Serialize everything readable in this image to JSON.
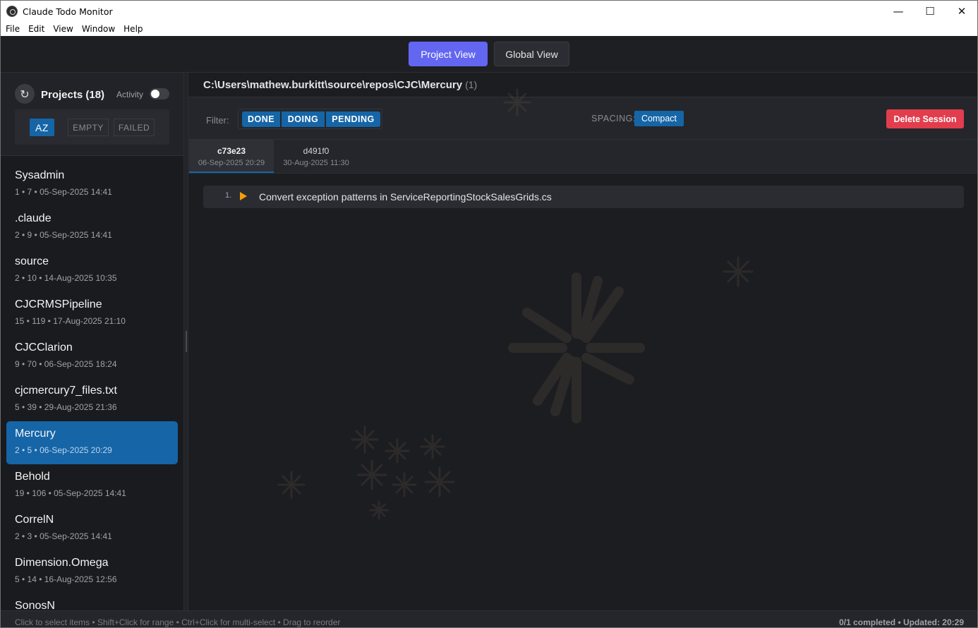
{
  "window": {
    "title": "Claude Todo Monitor",
    "minimize_glyph": "—",
    "maximize_glyph": "☐",
    "close_glyph": "✕"
  },
  "menu": [
    "File",
    "Edit",
    "View",
    "Window",
    "Help"
  ],
  "views": {
    "project": "Project View",
    "global": "Global View",
    "active": "project"
  },
  "sidebar": {
    "refresh_glyph": "↻",
    "title": "Projects (18)",
    "activity_label": "Activity",
    "activity_on": false,
    "sort": {
      "az": "AZ",
      "empty": "EMPTY",
      "failed": "FAILED",
      "active": "az"
    },
    "projects": [
      {
        "name": "Sysadmin",
        "meta": "1 • 7 • 05-Sep-2025 14:41"
      },
      {
        "name": ".claude",
        "meta": "2 • 9 • 05-Sep-2025 14:41"
      },
      {
        "name": "source",
        "meta": "2 • 10 • 14-Aug-2025 10:35"
      },
      {
        "name": "CJCRMSPipeline",
        "meta": "15 • 119 • 17-Aug-2025 21:10"
      },
      {
        "name": "CJCClarion",
        "meta": "9 • 70 • 06-Sep-2025 18:24"
      },
      {
        "name": "cjcmercury7_files.txt",
        "meta": "5 • 39 • 29-Aug-2025 21:36"
      },
      {
        "name": "Mercury",
        "meta": "2 • 5 • 06-Sep-2025 20:29",
        "selected": true
      },
      {
        "name": "Behold",
        "meta": "19 • 106 • 05-Sep-2025 14:41"
      },
      {
        "name": "CorrelN",
        "meta": "2 • 3 • 05-Sep-2025 14:41"
      },
      {
        "name": "Dimension.Omega",
        "meta": "5 • 14 • 16-Aug-2025 12:56"
      },
      {
        "name": "SonosN",
        "meta": ""
      }
    ]
  },
  "main": {
    "path": "C:\\Users\\mathew.burkitt\\source\\repos\\CJC\\Mercury",
    "path_count": "(1)",
    "filter_label": "Filter:",
    "filters": {
      "done": "DONE",
      "doing": "DOING",
      "pending": "PENDING"
    },
    "spacing_label": "SPACING:",
    "spacing_value": "Compact",
    "delete_label": "Delete Session",
    "sessions": [
      {
        "id": "c73e23",
        "date": "06-Sep-2025 20:29",
        "active": true
      },
      {
        "id": "d491f0",
        "date": "30-Aug-2025 11:30",
        "active": false
      }
    ],
    "todos": [
      {
        "number": "1.",
        "status": "doing",
        "text": "Convert exception patterns in ServiceReportingStockSalesGrids.cs"
      }
    ]
  },
  "status": {
    "hint": "Click to select items • Shift+Click for range • Ctrl+Click for multi-select • Drag to reorder",
    "summary": "0/1 completed • Updated: 20:29"
  },
  "colors": {
    "accent_view": "#6366f1",
    "accent_blue": "#1565a7",
    "danger": "#e23d4d",
    "doing_arrow": "#f59e0b",
    "background": "#1c1d21"
  }
}
